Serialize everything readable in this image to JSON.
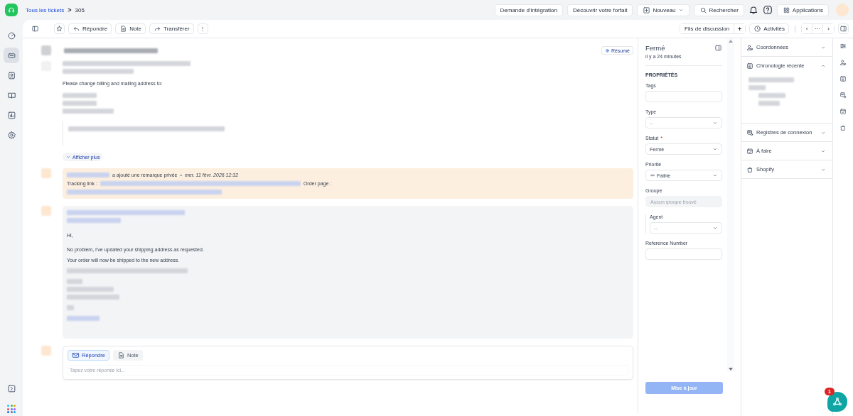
{
  "breadcrumb": {
    "parent": "Tous les tickets",
    "separator": ">",
    "current": "305"
  },
  "top_actions": [
    {
      "kind": "plain",
      "label": "Demande d’intégration"
    },
    {
      "kind": "plain",
      "label": "Découvrir votre forfait"
    },
    {
      "kind": "new",
      "label": "Nouveau"
    },
    {
      "kind": "search",
      "label": "Rechercher"
    },
    {
      "kind": "bell"
    },
    {
      "kind": "help"
    },
    {
      "kind": "apps",
      "label": "Applications"
    }
  ],
  "nav": [
    {
      "kind": "dashboard",
      "selected": false
    },
    {
      "kind": "tickets",
      "selected": true
    },
    {
      "kind": "contacts",
      "selected": false
    },
    {
      "kind": "book",
      "selected": false
    },
    {
      "kind": "reports",
      "selected": false
    },
    {
      "kind": "settings",
      "selected": false
    }
  ],
  "toolbar": {
    "left": [
      {
        "kind": "star"
      },
      {
        "kind": "reply",
        "label": "Répondre"
      },
      {
        "kind": "note",
        "label": "Note"
      },
      {
        "kind": "forward",
        "label": "Transférer"
      },
      {
        "kind": "more",
        "label": "⋮"
      }
    ],
    "threads": "Fils de discussion",
    "add": "+",
    "activities": "Activités",
    "pager": [
      "‹",
      "···",
      "›"
    ]
  },
  "messages": [
    {
      "kind": "email",
      "summary": "Résumé",
      "body": "Please change billing and mailing address to:",
      "show_more": "Afficher plus"
    },
    {
      "kind": "note",
      "action": "a ajouté une remarque privée",
      "dot": "•",
      "date": "mer. 11 févr. 2026 12:32",
      "tracking": "Tracking link :",
      "order": "Order page :"
    },
    {
      "kind": "reply",
      "lines": [
        "Hi,",
        "No problem, I've updated your shipping address as requested.",
        "Your order will now be shipped to the new address."
      ]
    }
  ],
  "composer": {
    "tabs": [
      {
        "kind": "reply",
        "label": "Répondre",
        "selected": true
      },
      {
        "kind": "note",
        "label": "Note",
        "selected": false
      }
    ],
    "placeholder": "Tapez votre réponse ici..."
  },
  "properties": {
    "status": "Fermé",
    "time": "il y a 24 minutes",
    "heading": "PROPRIÉTÉS",
    "fields": [
      {
        "kind": "text",
        "label": "Tags"
      },
      {
        "kind": "select",
        "label": "Type",
        "placeholder": "--"
      },
      {
        "kind": "select",
        "label": "Statut",
        "required_mark": "*",
        "value": "Fermé"
      },
      {
        "kind": "priority",
        "label": "Priorité",
        "value": "Faible"
      },
      {
        "kind": "disabled",
        "label": "Groupe",
        "placeholder": "Aucun groupe trouvé"
      },
      {
        "kind": "nested_select",
        "label": "Agent",
        "placeholder": "--"
      },
      {
        "kind": "text",
        "label": "Reference Number"
      }
    ],
    "update": {
      "label": "Mise à jour",
      "disabled": true
    }
  },
  "sections": [
    {
      "kind": "contact",
      "title": "Coordonnées",
      "expanded": false
    },
    {
      "kind": "timeline",
      "title": "Chronologie récente",
      "expanded": true
    },
    {
      "kind": "log",
      "title": "Registres de connexion",
      "expanded": false
    },
    {
      "kind": "todo",
      "title": "À faire",
      "expanded": false
    },
    {
      "kind": "shop",
      "title": "Shopify",
      "expanded": false
    }
  ],
  "right_rail": [
    {
      "kind": "sliders"
    },
    {
      "kind": "contact"
    },
    {
      "kind": "timeline"
    },
    {
      "kind": "log"
    },
    {
      "kind": "todo"
    },
    {
      "kind": "shop"
    }
  ],
  "chat_widget": {
    "badge": "1"
  }
}
